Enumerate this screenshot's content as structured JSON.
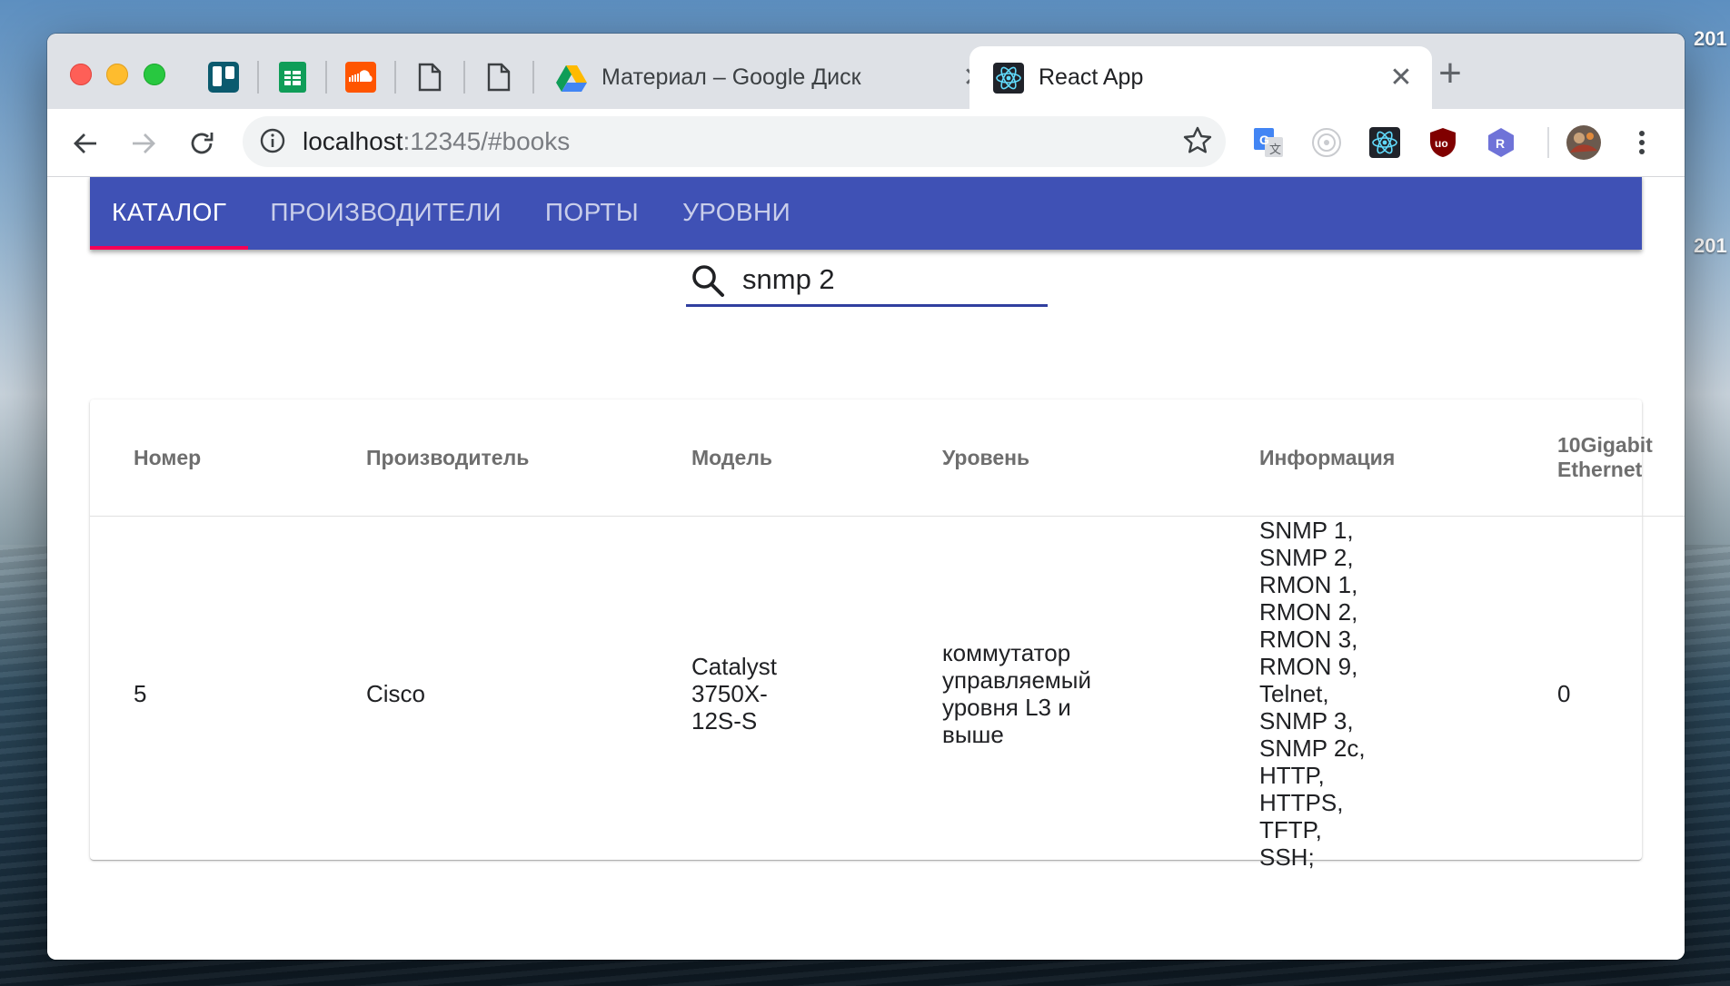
{
  "desktop": {
    "labels": [
      "201",
      "201"
    ]
  },
  "browser": {
    "pinned_tabs": [
      {
        "icon": "trello-icon"
      },
      {
        "icon": "google-sheets-icon"
      },
      {
        "icon": "soundcloud-icon"
      },
      {
        "icon": "document-icon"
      },
      {
        "icon": "document-icon"
      }
    ],
    "tabs": [
      {
        "title": "Материал – Google Диск",
        "icon": "google-drive-icon",
        "active": false
      },
      {
        "title": "React App",
        "icon": "react-icon",
        "active": true
      }
    ],
    "url_host": "localhost",
    "url_rest": ":12345/#books",
    "extensions": [
      "google-translate-icon",
      "extension-circle-icon",
      "react-devtools-icon",
      "ublock-icon",
      "redux-icon",
      "profile-avatar"
    ]
  },
  "app": {
    "tabs": [
      "КАТАЛОГ",
      "ПРОИЗВОДИТЕЛИ",
      "ПОРТЫ",
      "УРОВНИ"
    ],
    "search_value": "snmp 2",
    "table": {
      "headers": [
        "Номер",
        "Производитель",
        "Модель",
        "Уровень",
        "Информация",
        "10Gigabit Ethernet"
      ],
      "rows": [
        {
          "number": "5",
          "manufacturer": "Cisco",
          "model": "Catalyst 3750X-12S-S",
          "level": "коммутатор управляемый уровня L3 и выше",
          "info": "SNMP 1, SNMP 2, RMON 1, RMON 2, RMON 3, RMON 9, Telnet, SNMP 3, SNMP 2c, HTTP, HTTPS, TFTP, SSH;",
          "ten_gig": "0"
        }
      ]
    }
  },
  "colors": {
    "appbar": "#3f51b5",
    "tab_indicator": "#f50057",
    "search_underline": "#303f9f"
  }
}
